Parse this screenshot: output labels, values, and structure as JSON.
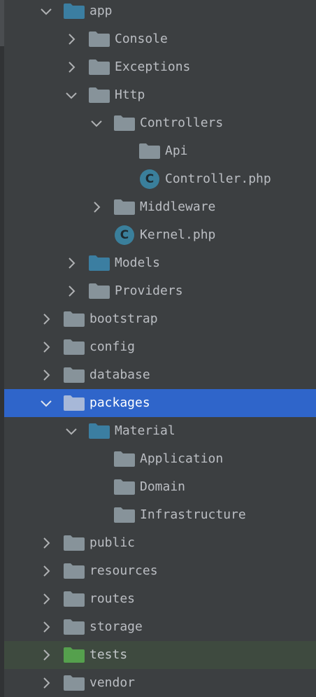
{
  "colors": {
    "folder": "#87939a",
    "folder_source": "#3b7ea1",
    "folder_test": "#55a04d",
    "folder_selected": "#a7b8d8",
    "class_badge": "#3a7f9b",
    "selection": "#2f65ca",
    "tests_row": "#3e4a3f"
  },
  "tree": {
    "items": [
      {
        "label": "app",
        "expanded": true,
        "folder_kind": "source"
      },
      {
        "label": "Console",
        "expanded": false,
        "folder_kind": "plain"
      },
      {
        "label": "Exceptions",
        "expanded": false,
        "folder_kind": "plain"
      },
      {
        "label": "Http",
        "expanded": true,
        "folder_kind": "plain"
      },
      {
        "label": "Controllers",
        "expanded": true,
        "folder_kind": "plain"
      },
      {
        "label": "Api",
        "folder_kind": "plain"
      },
      {
        "label": "Controller.php",
        "file_icon": "class-icon",
        "badge_letter": "C"
      },
      {
        "label": "Middleware",
        "expanded": false,
        "folder_kind": "plain"
      },
      {
        "label": "Kernel.php",
        "file_icon": "class-icon",
        "badge_letter": "C"
      },
      {
        "label": "Models",
        "expanded": false,
        "folder_kind": "source"
      },
      {
        "label": "Providers",
        "expanded": false,
        "folder_kind": "plain"
      },
      {
        "label": "bootstrap",
        "expanded": false,
        "folder_kind": "plain"
      },
      {
        "label": "config",
        "expanded": false,
        "folder_kind": "plain"
      },
      {
        "label": "database",
        "expanded": false,
        "folder_kind": "plain"
      },
      {
        "label": "packages",
        "expanded": true,
        "folder_kind": "selected",
        "selected": true
      },
      {
        "label": "Material",
        "expanded": true,
        "folder_kind": "source"
      },
      {
        "label": "Application",
        "folder_kind": "plain"
      },
      {
        "label": "Domain",
        "folder_kind": "plain"
      },
      {
        "label": "Infrastructure",
        "folder_kind": "plain"
      },
      {
        "label": "public",
        "expanded": false,
        "folder_kind": "plain"
      },
      {
        "label": "resources",
        "expanded": false,
        "folder_kind": "plain"
      },
      {
        "label": "routes",
        "expanded": false,
        "folder_kind": "plain"
      },
      {
        "label": "storage",
        "expanded": false,
        "folder_kind": "plain"
      },
      {
        "label": "tests",
        "expanded": false,
        "folder_kind": "test"
      },
      {
        "label": "vendor",
        "expanded": false,
        "folder_kind": "plain"
      }
    ]
  }
}
